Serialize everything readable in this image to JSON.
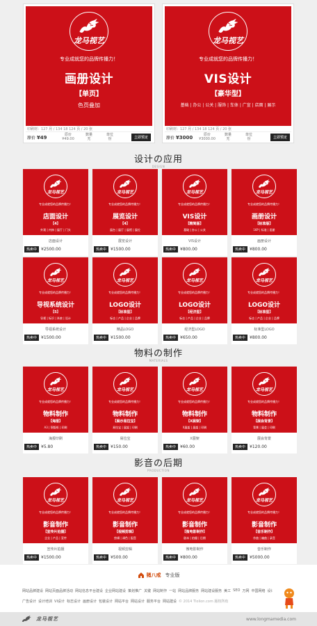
{
  "brand": {
    "name": "龙马视艺",
    "slogan": "专业成就您的品牌传播力！"
  },
  "featured": [
    {
      "title": "画册设计",
      "bracket": "【单页】",
      "tagline": "色页叠加",
      "info": "印刷材：127 月 / 134 18 124 页 / 20 张",
      "price_label": "原价",
      "price": "¥49",
      "col1": [
        "原价",
        "¥49.00"
      ],
      "col2": [
        "数量",
        "无"
      ],
      "col3": [
        "单位",
        "份"
      ],
      "button": "立即预定"
    },
    {
      "title": "VIS设计",
      "bracket": "【豪华型】",
      "tagline": "基础 | 办公 | 公关 | 服饰 | 车体 | 广宣 | 店面 | 展示",
      "info": "印刷材：127 月 / 134 18 124 页 / 20 张",
      "price_label": "原价",
      "price": "¥3000",
      "col1": [
        "原价",
        "¥3000.00"
      ],
      "col2": [
        "数量",
        "无"
      ],
      "col3": [
        "单位",
        "份"
      ],
      "button": "立即预定"
    }
  ],
  "sections": [
    {
      "zh": "设计の应用",
      "en": "DESIGN",
      "items": [
        {
          "title": "店面设计",
          "bracket": "【4】",
          "desc": "外观 | 内饰 | 展厅 | 门头",
          "name": "店面设计",
          "tag": "热卖中",
          "price": "¥2500.00"
        },
        {
          "title": "展览设计",
          "bracket": "【4】",
          "desc": "展台 | 展厅 | 展馆 | 展位",
          "name": "展览设计",
          "tag": "热卖中",
          "price": "¥1500.00"
        },
        {
          "title": "VIS设计",
          "bracket": "【精简版】",
          "desc": "基础 | 办公 | 公关",
          "name": "VIS设计",
          "tag": "热卖中",
          "price": "¥800.00"
        },
        {
          "title": "画册设计",
          "bracket": "【标准版】",
          "desc": "16P | 标准 | 画册",
          "name": "画册设计",
          "tag": "热卖中",
          "price": "¥800.00"
        },
        {
          "title": "导视系统设计",
          "bracket": "【5】",
          "desc": "导视 | 标识 | 系统 | 设计",
          "name": "导视系统设计",
          "tag": "热卖中",
          "price": "¥1500.00"
        },
        {
          "title": "LOGO设计",
          "bracket": "【标准型】",
          "desc": "标志 | 产品 | 企业 | 品牌",
          "name": "精品LOGO",
          "tag": "热卖中",
          "price": "¥1500.00"
        },
        {
          "title": "LOGO设计",
          "bracket": "【经济型】",
          "desc": "标志 | 产品 | 企业 | 品牌",
          "name": "经济型LOGO",
          "tag": "热卖中",
          "price": "¥650.00"
        },
        {
          "title": "LOGO设计",
          "bracket": "【标准型】",
          "desc": "标志 | 产品 | 企业 | 品牌",
          "name": "标准型LOGO",
          "tag": "热卖中",
          "price": "¥800.00"
        }
      ]
    },
    {
      "zh": "物料の制作",
      "en": "MATERIALS",
      "items": [
        {
          "title": "物料制作",
          "bracket": "【海报】",
          "desc": "A3 | 铜版纸 | 印刷",
          "name": "海报印刷",
          "tag": "热卖中",
          "price": "¥5.80"
        },
        {
          "title": "物料制作",
          "bracket": "【展示易拉宝】",
          "desc": "易拉宝 | 展架 | 印刷",
          "name": "易拉宝",
          "tag": "热卖中",
          "price": "¥150.00"
        },
        {
          "title": "物料制作",
          "bracket": "【X展架】",
          "desc": "X展架 | 展架 | 印刷",
          "name": "X展架",
          "tag": "热卖中",
          "price": "¥60.00"
        },
        {
          "title": "物料制作",
          "bracket": "【展会背景】",
          "desc": "背景 | 展会 | 印刷",
          "name": "展会背景",
          "tag": "热卖中",
          "price": "¥120.00"
        }
      ]
    },
    {
      "zh": "影音の后期",
      "en": "PRODUCTION",
      "items": [
        {
          "title": "影音制作",
          "bracket": "【宣传片拍摄】",
          "desc": "企业 | 产品 | 宣传",
          "name": "宣传片拍摄",
          "tag": "热卖中",
          "price": "¥1500.00"
        },
        {
          "title": "影音制作",
          "bracket": "【视频剪辑】",
          "desc": "剪辑 | 调色 | 配音",
          "name": "视频剪辑",
          "tag": "热卖中",
          "price": "¥500.00"
        },
        {
          "title": "影音制作",
          "bracket": "【微电影制作】",
          "desc": "剧本 | 拍摄 | 后期",
          "name": "微电影制作",
          "tag": "热卖中",
          "price": "¥800.00"
        },
        {
          "title": "影音制作",
          "bracket": "【音乐制作】",
          "desc": "作曲 | 编曲 | 录音",
          "name": "音乐制作",
          "tag": "热卖中",
          "price": "¥5000.00"
        }
      ]
    }
  ],
  "footer": {
    "brand": "猪八戒",
    "sub": "专业版",
    "row1": [
      "网站品牌建设",
      "网站页面品牌活动",
      "网站信息平台建设",
      "企业网站建设",
      "策划推广",
      "关键",
      "网站制作",
      "一站",
      "网站品牌服务",
      "网站建设服务",
      "美工",
      "SEO",
      "万网",
      "中国网络",
      "设计站"
    ],
    "row2": [
      "广告设计",
      "设计培训",
      "VI设计",
      "标志设计",
      "画册设计",
      "包装设计",
      "网站平台",
      "网站设计",
      "服务平台",
      "网站建设"
    ],
    "copyright": "© 2014 Tlolion.com 版权所有",
    "bottom_brand": "龙马视艺",
    "url": "www.longmamedia.com"
  },
  "colors": {
    "poster_red": "#cc1018",
    "tag_dark": "#222222",
    "footer_orange": "#d24b0c"
  }
}
